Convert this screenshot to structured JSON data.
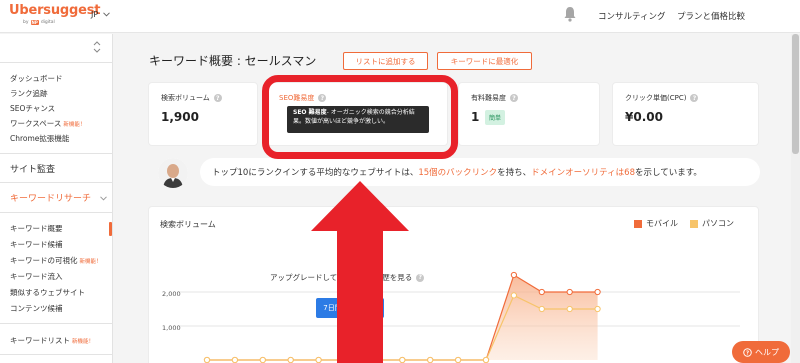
{
  "header": {
    "logo": "Ubersuggest",
    "logo_by": "by",
    "logo_brand": "NP",
    "logo_brand_suffix": "digital",
    "language": "JP",
    "nav": [
      "コンサルティング",
      "プランと価格比較"
    ]
  },
  "sidebar": {
    "items_top": [
      {
        "label": "ダッシュボード",
        "badge": ""
      },
      {
        "label": "ランク追跡",
        "badge": ""
      },
      {
        "label": "SEOチャンス",
        "badge": ""
      },
      {
        "label": "ワークスペース",
        "badge": "新機能！"
      },
      {
        "label": "Chrome拡張機能",
        "badge": ""
      }
    ],
    "section_audit": "サイト監査",
    "section_keyword": "キーワードリサーチ",
    "items_keyword": [
      {
        "label": "キーワード概要",
        "badge": ""
      },
      {
        "label": "キーワード候補",
        "badge": ""
      },
      {
        "label": "キーワードの可視化",
        "badge": "新機能！"
      },
      {
        "label": "キーワード流入",
        "badge": ""
      },
      {
        "label": "類似するウェブサイト",
        "badge": ""
      },
      {
        "label": "コンテンツ候補",
        "badge": ""
      }
    ],
    "item_keyword_list": {
      "label": "キーワードリスト",
      "badge": "新機能！"
    }
  },
  "main": {
    "title": "キーワード概要 : セールスマン",
    "btn_add_list": "リストに追加する",
    "btn_optimize": "キーワードに最適化",
    "metrics": [
      {
        "label": "検索ボリューム",
        "value": "1,900"
      },
      {
        "label": "SEO難易度",
        "value": ""
      },
      {
        "label": "有料難易度",
        "value": "1",
        "badge": "簡単"
      },
      {
        "label": "クリック単価(CPC)",
        "value": "¥0.00"
      }
    ],
    "tooltip": {
      "strong": "SEO 難易度",
      "text": "- オーガニック検索の競合分析結果。数値が高いほど競争が激しい。"
    },
    "info": {
      "pre": "トップ10にランクインする平均的なウェブサイトは、",
      "backlinks": "15個のバックリンク",
      "mid": "を持ち、",
      "authority": "ドメインオーソリティは68",
      "post": "を示しています。"
    },
    "chart": {
      "title": "検索ボリューム",
      "legend_mobile": "モバイル",
      "legend_pc": "パソコン",
      "upgrade": "アップグレードしてキーワード履歴を見る",
      "trial_button": "7日間無料お試し",
      "yticks": [
        "2,000",
        "1,000"
      ]
    },
    "help_button": "ヘルプ"
  },
  "colors": {
    "accent": "#f06b3a",
    "mobile": "#f06b3a",
    "pc": "#f7c46a",
    "highlight": "#e8222a",
    "trial": "#2c7be5"
  },
  "chart_data": {
    "type": "area",
    "title": "検索ボリューム",
    "series": [
      {
        "name": "モバイル",
        "values": [
          0,
          0,
          0,
          0,
          0,
          0,
          0,
          0,
          0,
          0,
          0,
          2500,
          2000,
          2000,
          2000
        ]
      },
      {
        "name": "パソコン",
        "values": [
          0,
          0,
          0,
          0,
          0,
          0,
          0,
          0,
          0,
          0,
          0,
          1900,
          1500,
          1500,
          1500
        ]
      }
    ],
    "yticks": [
      "2,000",
      "1,000"
    ]
  }
}
